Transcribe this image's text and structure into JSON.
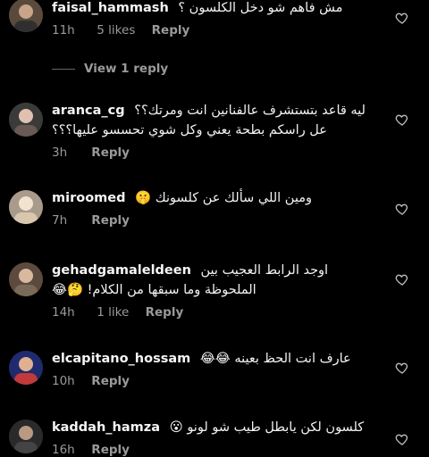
{
  "comments": [
    {
      "username": "faisal_hammash",
      "text": "مش فاهم شو دخل الكلسون ؟",
      "time": "11h",
      "likes": "5 likes",
      "reply": "Reply",
      "view_replies": "View 1 reply",
      "avatar_colors": [
        "#6b5a49",
        "#c8a58a"
      ]
    },
    {
      "username": "aranca_cg",
      "text": "ليه قاعد بتستشرف عالفنانين انت ومرتك؟؟",
      "text2": "عل راسكم بطحة يعني وكل شوي تحسسو عليها؟؟؟",
      "time": "3h",
      "reply": "Reply",
      "avatar_colors": [
        "#3a3a3a",
        "#e0c0b0"
      ]
    },
    {
      "username": "miroomed",
      "text": "ومين اللي سألك عن كلسونك 🤫",
      "time": "7h",
      "reply": "Reply",
      "avatar_colors": [
        "#a89b8c",
        "#f1e3d0"
      ]
    },
    {
      "username": "gehadgamaleldeen",
      "text": "اوجد الرابط العجيب بين",
      "text2": "الملحوظة وما سبقها من الكلام! 🤔😂",
      "time": "14h",
      "likes": "1 like",
      "reply": "Reply",
      "avatar_colors": [
        "#5c4a3f",
        "#d9b8a0"
      ]
    },
    {
      "username": "elcapitano_hossam",
      "text": "عارف انت الحظ بعينه 😂😂",
      "time": "10h",
      "reply": "Reply",
      "avatar_colors": [
        "#1f2b6e",
        "#e05a5a"
      ]
    },
    {
      "username": "kaddah_hamza",
      "text": "كلسون لكن يابطل طيب شو لونو 😮",
      "time": "16h",
      "reply": "Reply",
      "avatar_colors": [
        "#2a2a2a",
        "#b89a84"
      ]
    }
  ],
  "icons": {
    "like": "heart-outline-icon"
  },
  "colors": {
    "background": "#000000",
    "secondary_text": "#9a9a9a"
  }
}
